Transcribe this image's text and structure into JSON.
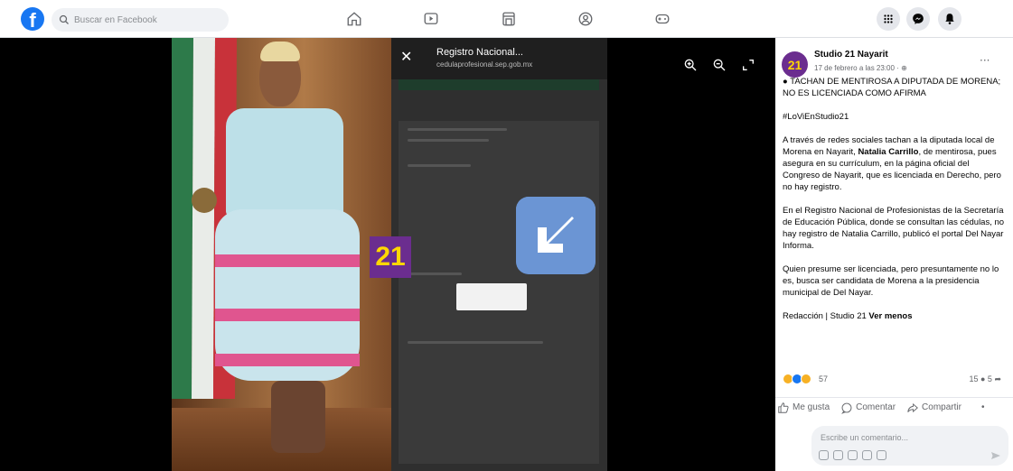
{
  "topbar": {
    "search_placeholder": "Buscar en Facebook",
    "nav_icons": [
      "home-icon",
      "video-icon",
      "marketplace-icon",
      "groups-icon",
      "gaming-icon"
    ],
    "right_icons": [
      "menu-grid-icon",
      "messenger-icon",
      "notifications-icon"
    ]
  },
  "viewer": {
    "phone": {
      "title": "Registro Nacional...",
      "url": "cedulaprofesional.sep.gob.mx"
    },
    "brand_mark": "21",
    "controls": [
      "zoom-in-icon",
      "zoom-out-icon",
      "fullscreen-icon"
    ]
  },
  "post": {
    "page_name": "Studio 21 Nayarit",
    "date": "17 de febrero a las 23:00 · ",
    "headline": "TACHAN DE MENTIROSA A DIPUTADA DE MORENA; NO ES LICENCIADA COMO AFIRMA",
    "hashtag": "#LoViEnStudio21",
    "p1_a": "A través de redes sociales tachan a la diputada local de Morena en Nayarit, ",
    "p1_bold": "Natalia Carrillo",
    "p1_b": ", de mentirosa, pues asegura en su currículum, en la página oficial del Congreso de Nayarit, que es licenciada en Derecho, pero no hay registro.",
    "p2": "En el Registro Nacional de Profesionistas de la Secretaría de Educación Pública, donde se consultan las cédulas, no hay registro de Natalia Carrillo, publicó el portal Del Nayar Informa.",
    "p3": "Quien presume ser licenciada, pero presuntamente no lo es, busca ser candidata de Morena a la presidencia municipal de Del Nayar.",
    "credit": "Redacción | Studio 21 ",
    "see_less": "Ver menos",
    "reaction_count": "57",
    "comments_count": "15",
    "shares_count": "5",
    "like_label": "Me gusta",
    "comment_label": "Comentar",
    "share_label": "Compartir",
    "comment_placeholder": "Escribe un comentario..."
  },
  "colors": {
    "facebook_blue": "#1877f2",
    "brand_purple": "#6b2d8f",
    "brand_yellow": "#ffd700"
  }
}
